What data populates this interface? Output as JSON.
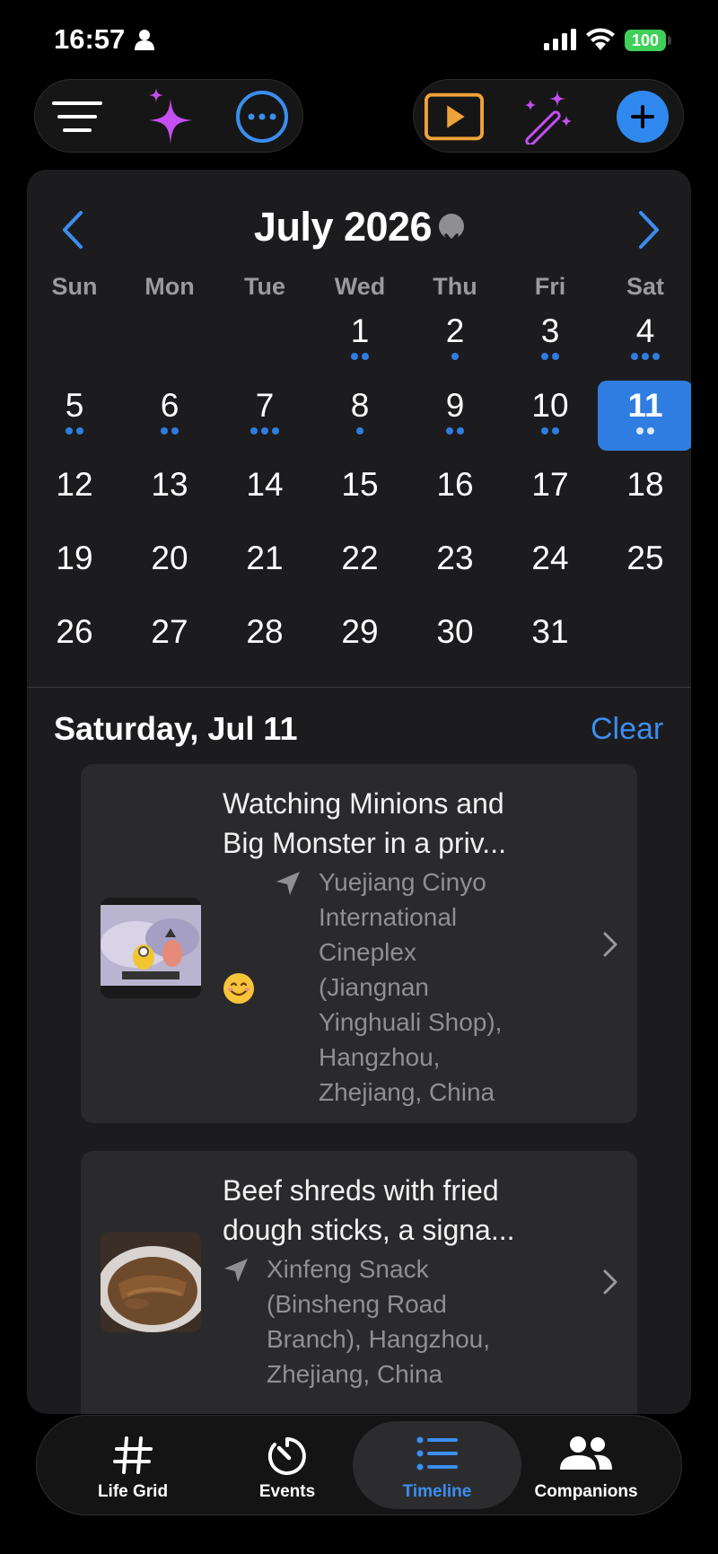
{
  "status_bar": {
    "time": "16:57",
    "battery": "100"
  },
  "toolbar_left": {
    "items": [
      "menu-icon",
      "sparkles-icon",
      "more-icon"
    ]
  },
  "toolbar_right": {
    "items": [
      "slideshow-icon",
      "magic-wand-icon",
      "add-icon"
    ]
  },
  "calendar": {
    "month_title": "July 2026",
    "weekdays": [
      "Sun",
      "Mon",
      "Tue",
      "Wed",
      "Thu",
      "Fri",
      "Sat"
    ],
    "weeks": [
      [
        null,
        null,
        null,
        {
          "d": "1",
          "dots": 2
        },
        {
          "d": "2",
          "dots": 1
        },
        {
          "d": "3",
          "dots": 2
        },
        {
          "d": "4",
          "dots": 3
        }
      ],
      [
        {
          "d": "5",
          "dots": 2
        },
        {
          "d": "6",
          "dots": 2
        },
        {
          "d": "7",
          "dots": 3
        },
        {
          "d": "8",
          "dots": 1
        },
        {
          "d": "9",
          "dots": 2
        },
        {
          "d": "10",
          "dots": 2
        },
        {
          "d": "11",
          "dots": 2,
          "selected": true
        }
      ],
      [
        {
          "d": "12",
          "dots": 0
        },
        {
          "d": "13",
          "dots": 0
        },
        {
          "d": "14",
          "dots": 0
        },
        {
          "d": "15",
          "dots": 0
        },
        {
          "d": "16",
          "dots": 0
        },
        {
          "d": "17",
          "dots": 0
        },
        {
          "d": "18",
          "dots": 0
        }
      ],
      [
        {
          "d": "19",
          "dots": 0
        },
        {
          "d": "20",
          "dots": 0
        },
        {
          "d": "21",
          "dots": 0
        },
        {
          "d": "22",
          "dots": 0
        },
        {
          "d": "23",
          "dots": 0
        },
        {
          "d": "24",
          "dots": 0
        },
        {
          "d": "25",
          "dots": 0
        }
      ],
      [
        {
          "d": "26",
          "dots": 0
        },
        {
          "d": "27",
          "dots": 0
        },
        {
          "d": "28",
          "dots": 0
        },
        {
          "d": "29",
          "dots": 0
        },
        {
          "d": "30",
          "dots": 0
        },
        {
          "d": "31",
          "dots": 0
        },
        null
      ]
    ],
    "accent_color": "#2f7de1"
  },
  "selected_day": {
    "label": "Saturday, Jul 11",
    "clear_label": "Clear"
  },
  "events": [
    {
      "title_line1": "Watching Minions and",
      "title_line2": "Big Monster in a priv...",
      "location_lines": [
        "Yuejiang Cinyo",
        "International",
        "Cineplex",
        "(Jiangnan",
        "Yinghuali Shop),",
        "Hangzhou,",
        "Zhejiang, China"
      ],
      "mood": "smiling-face-emoji"
    },
    {
      "title_line1": "Beef shreds with fried",
      "title_line2": "dough sticks, a signa...",
      "location_lines": [
        "Xinfeng Snack",
        "(Binsheng Road",
        "Branch), Hangzhou,",
        "Zhejiang, China"
      ]
    }
  ],
  "tabs": [
    {
      "label": "Life Grid",
      "icon": "hash-icon"
    },
    {
      "label": "Events",
      "icon": "timer-icon"
    },
    {
      "label": "Timeline",
      "icon": "list-icon",
      "active": true
    },
    {
      "label": "Companions",
      "icon": "people-icon"
    }
  ]
}
